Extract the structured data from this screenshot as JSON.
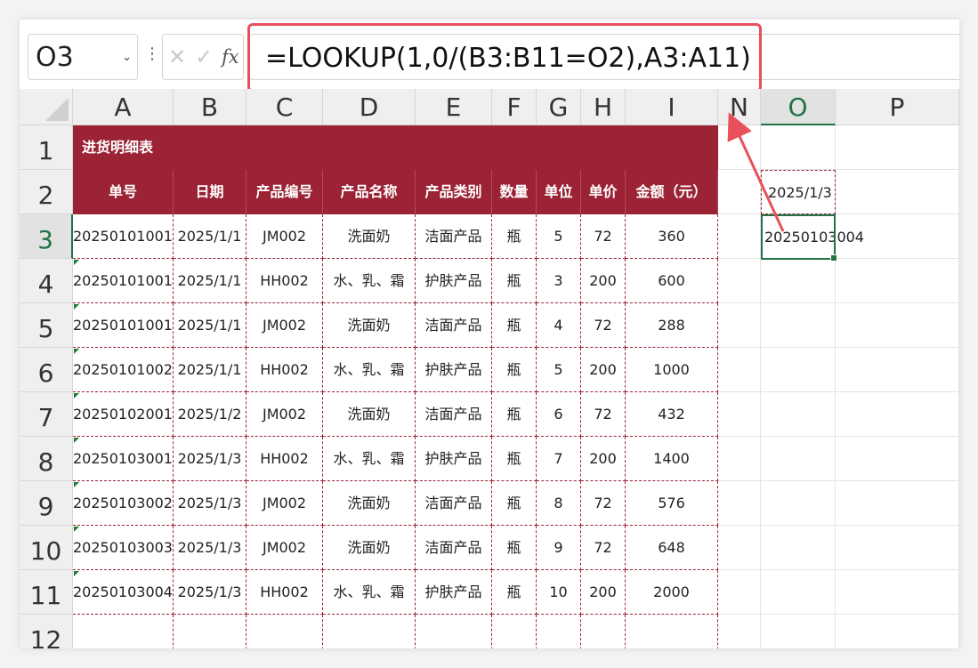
{
  "formula_bar": {
    "name_box": "O3",
    "formula": "=LOOKUP(1,0/(B3:B11=O2),A3:A11)",
    "fx_label": "fx"
  },
  "columns": [
    "A",
    "B",
    "C",
    "D",
    "E",
    "F",
    "G",
    "H",
    "I",
    "N",
    "O",
    "P"
  ],
  "active_column": "O",
  "rows": [
    "1",
    "2",
    "3",
    "4",
    "5",
    "6",
    "7",
    "8",
    "9",
    "10",
    "11",
    "12"
  ],
  "active_row": "3",
  "table": {
    "title": "进货明细表",
    "headers": [
      "单号",
      "日期",
      "产品编号",
      "产品名称",
      "产品类别",
      "数量",
      "单位",
      "单价",
      "金额（元）"
    ],
    "rows": [
      [
        "20250101001",
        "2025/1/1",
        "JM002",
        "洗面奶",
        "洁面产品",
        "瓶",
        "5",
        "72",
        "360"
      ],
      [
        "20250101001",
        "2025/1/1",
        "HH002",
        "水、乳、霜",
        "护肤产品",
        "瓶",
        "3",
        "200",
        "600"
      ],
      [
        "20250101001",
        "2025/1/1",
        "JM002",
        "洗面奶",
        "洁面产品",
        "瓶",
        "4",
        "72",
        "288"
      ],
      [
        "20250101002",
        "2025/1/1",
        "HH002",
        "水、乳、霜",
        "护肤产品",
        "瓶",
        "5",
        "200",
        "1000"
      ],
      [
        "20250102001",
        "2025/1/2",
        "JM002",
        "洗面奶",
        "洁面产品",
        "瓶",
        "6",
        "72",
        "432"
      ],
      [
        "20250103001",
        "2025/1/3",
        "HH002",
        "水、乳、霜",
        "护肤产品",
        "瓶",
        "7",
        "200",
        "1400"
      ],
      [
        "20250103002",
        "2025/1/3",
        "JM002",
        "洗面奶",
        "洁面产品",
        "瓶",
        "8",
        "72",
        "576"
      ],
      [
        "20250103003",
        "2025/1/3",
        "JM002",
        "洗面奶",
        "洁面产品",
        "瓶",
        "9",
        "72",
        "648"
      ],
      [
        "20250103004",
        "2025/1/3",
        "HH002",
        "水、乳、霜",
        "护肤产品",
        "瓶",
        "10",
        "200",
        "2000"
      ]
    ]
  },
  "lookup": {
    "o2_value": "2025/1/3",
    "o3_value": "20250103004"
  },
  "colors": {
    "header_bg": "#9b2335",
    "highlight": "#e8505b",
    "selection": "#217346"
  }
}
